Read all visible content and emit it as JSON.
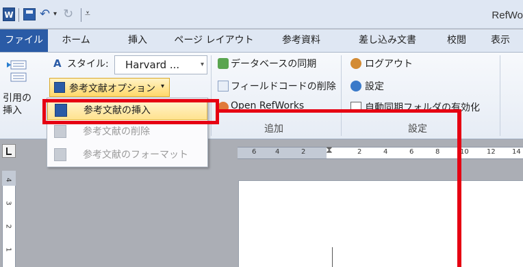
{
  "titlebar": {
    "app_icon": "W",
    "window_title": "RefWo"
  },
  "tabs": [
    "ファイル",
    "ホーム",
    "挿入",
    "ページ レイアウト",
    "参考資料",
    "差し込み文書",
    "校閲",
    "表示"
  ],
  "ribbon": {
    "cite_label_1": "引用の",
    "cite_label_2": "挿入",
    "style_label": "スタイル:",
    "style_value": "Harvard ...",
    "ref_options_button": "参考文献オプション",
    "sync_db": "データベースの同期",
    "remove_field_codes": "フィールドコードの削除",
    "open_refworks": "Open RefWorks",
    "logout": "ログアウト",
    "settings": "設定",
    "auto_sync": "自動同期フォルダの有効化",
    "group_add": "追加",
    "group_settings": "設定"
  },
  "menu": {
    "items": [
      {
        "label": "参考文献の挿入",
        "enabled": true
      },
      {
        "label": "参考文献の削除",
        "enabled": false
      },
      {
        "label": "参考文献のフォーマット",
        "enabled": false
      }
    ]
  },
  "ruler": {
    "h_ticks": [
      "6",
      "4",
      "2",
      "2",
      "4",
      "6",
      "8",
      "10",
      "12",
      "14"
    ],
    "v_ticks": [
      "4",
      "3",
      "2",
      "1"
    ]
  },
  "colors": {
    "annotation": "#e60012",
    "file_tab": "#2a5ba6"
  }
}
